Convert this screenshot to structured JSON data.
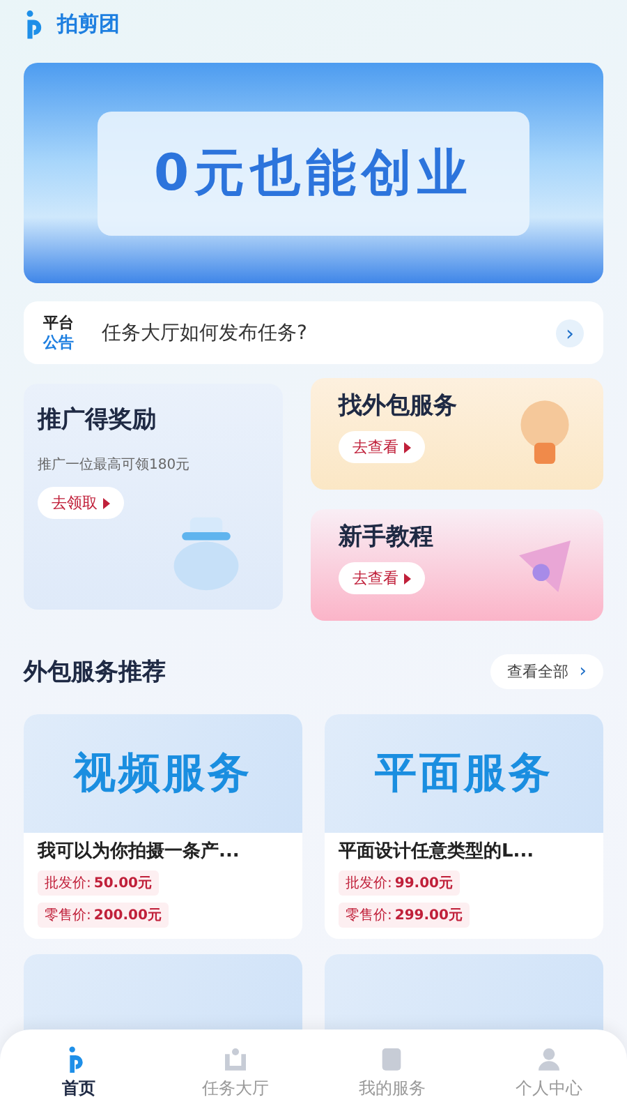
{
  "app": {
    "name": "拍剪团"
  },
  "banner": {
    "title": "0元也能创业"
  },
  "notice": {
    "label_top": "平台",
    "label_bottom": "公告",
    "text": "任务大厅如何发布任务?",
    "arrow": "›"
  },
  "promo": {
    "title": "推广得奖励",
    "subtitle": "推广一位最高可领180元",
    "button": "去领取"
  },
  "features": [
    {
      "kind": "outsource",
      "title": "找外包服务",
      "button": "去查看"
    },
    {
      "kind": "tutorial",
      "title": "新手教程",
      "button": "去查看"
    }
  ],
  "section": {
    "title": "外包服务推荐",
    "more": "查看全部",
    "arrow": "›"
  },
  "services": [
    {
      "banner": "视频服务",
      "title": "我可以为你拍摄一条产...",
      "wholesale_label": "批发价:",
      "wholesale": "50.00元",
      "retail_label": "零售价:",
      "retail": "200.00元"
    },
    {
      "banner": "平面服务",
      "title": "平面设计任意类型的L...",
      "wholesale_label": "批发价:",
      "wholesale": "99.00元",
      "retail_label": "零售价:",
      "retail": "299.00元"
    }
  ],
  "tabs": [
    {
      "label": "首页",
      "kind": "home",
      "selected": true
    },
    {
      "label": "任务大厅",
      "kind": "hall",
      "selected": false
    },
    {
      "label": "我的服务",
      "kind": "service",
      "selected": false
    },
    {
      "label": "个人中心",
      "kind": "profile",
      "selected": false
    }
  ]
}
